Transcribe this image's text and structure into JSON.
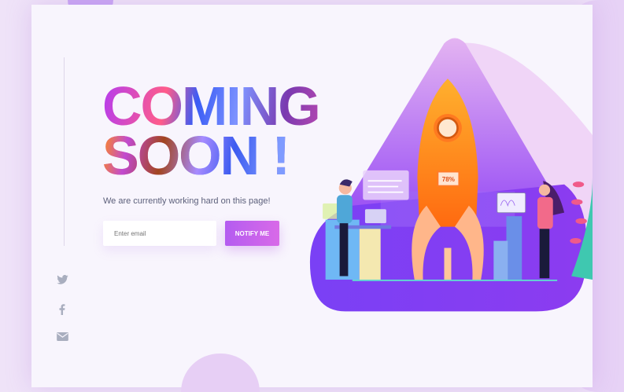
{
  "hero": {
    "title_line1": "COMING",
    "title_line2": "SOON !",
    "subtitle": "We are currently working hard on this page!"
  },
  "form": {
    "email_placeholder": "Enter email",
    "email_value": "",
    "notify_label": "NOTIFY ME"
  },
  "social": [
    "twitter-icon",
    "facebook-icon",
    "mail-icon"
  ],
  "illustration": {
    "rocket_progress_label": "78%"
  },
  "colors": {
    "accent": "#c05ced",
    "illustration_base": "#7a3cf5",
    "rocket": "#ff8a1c"
  }
}
